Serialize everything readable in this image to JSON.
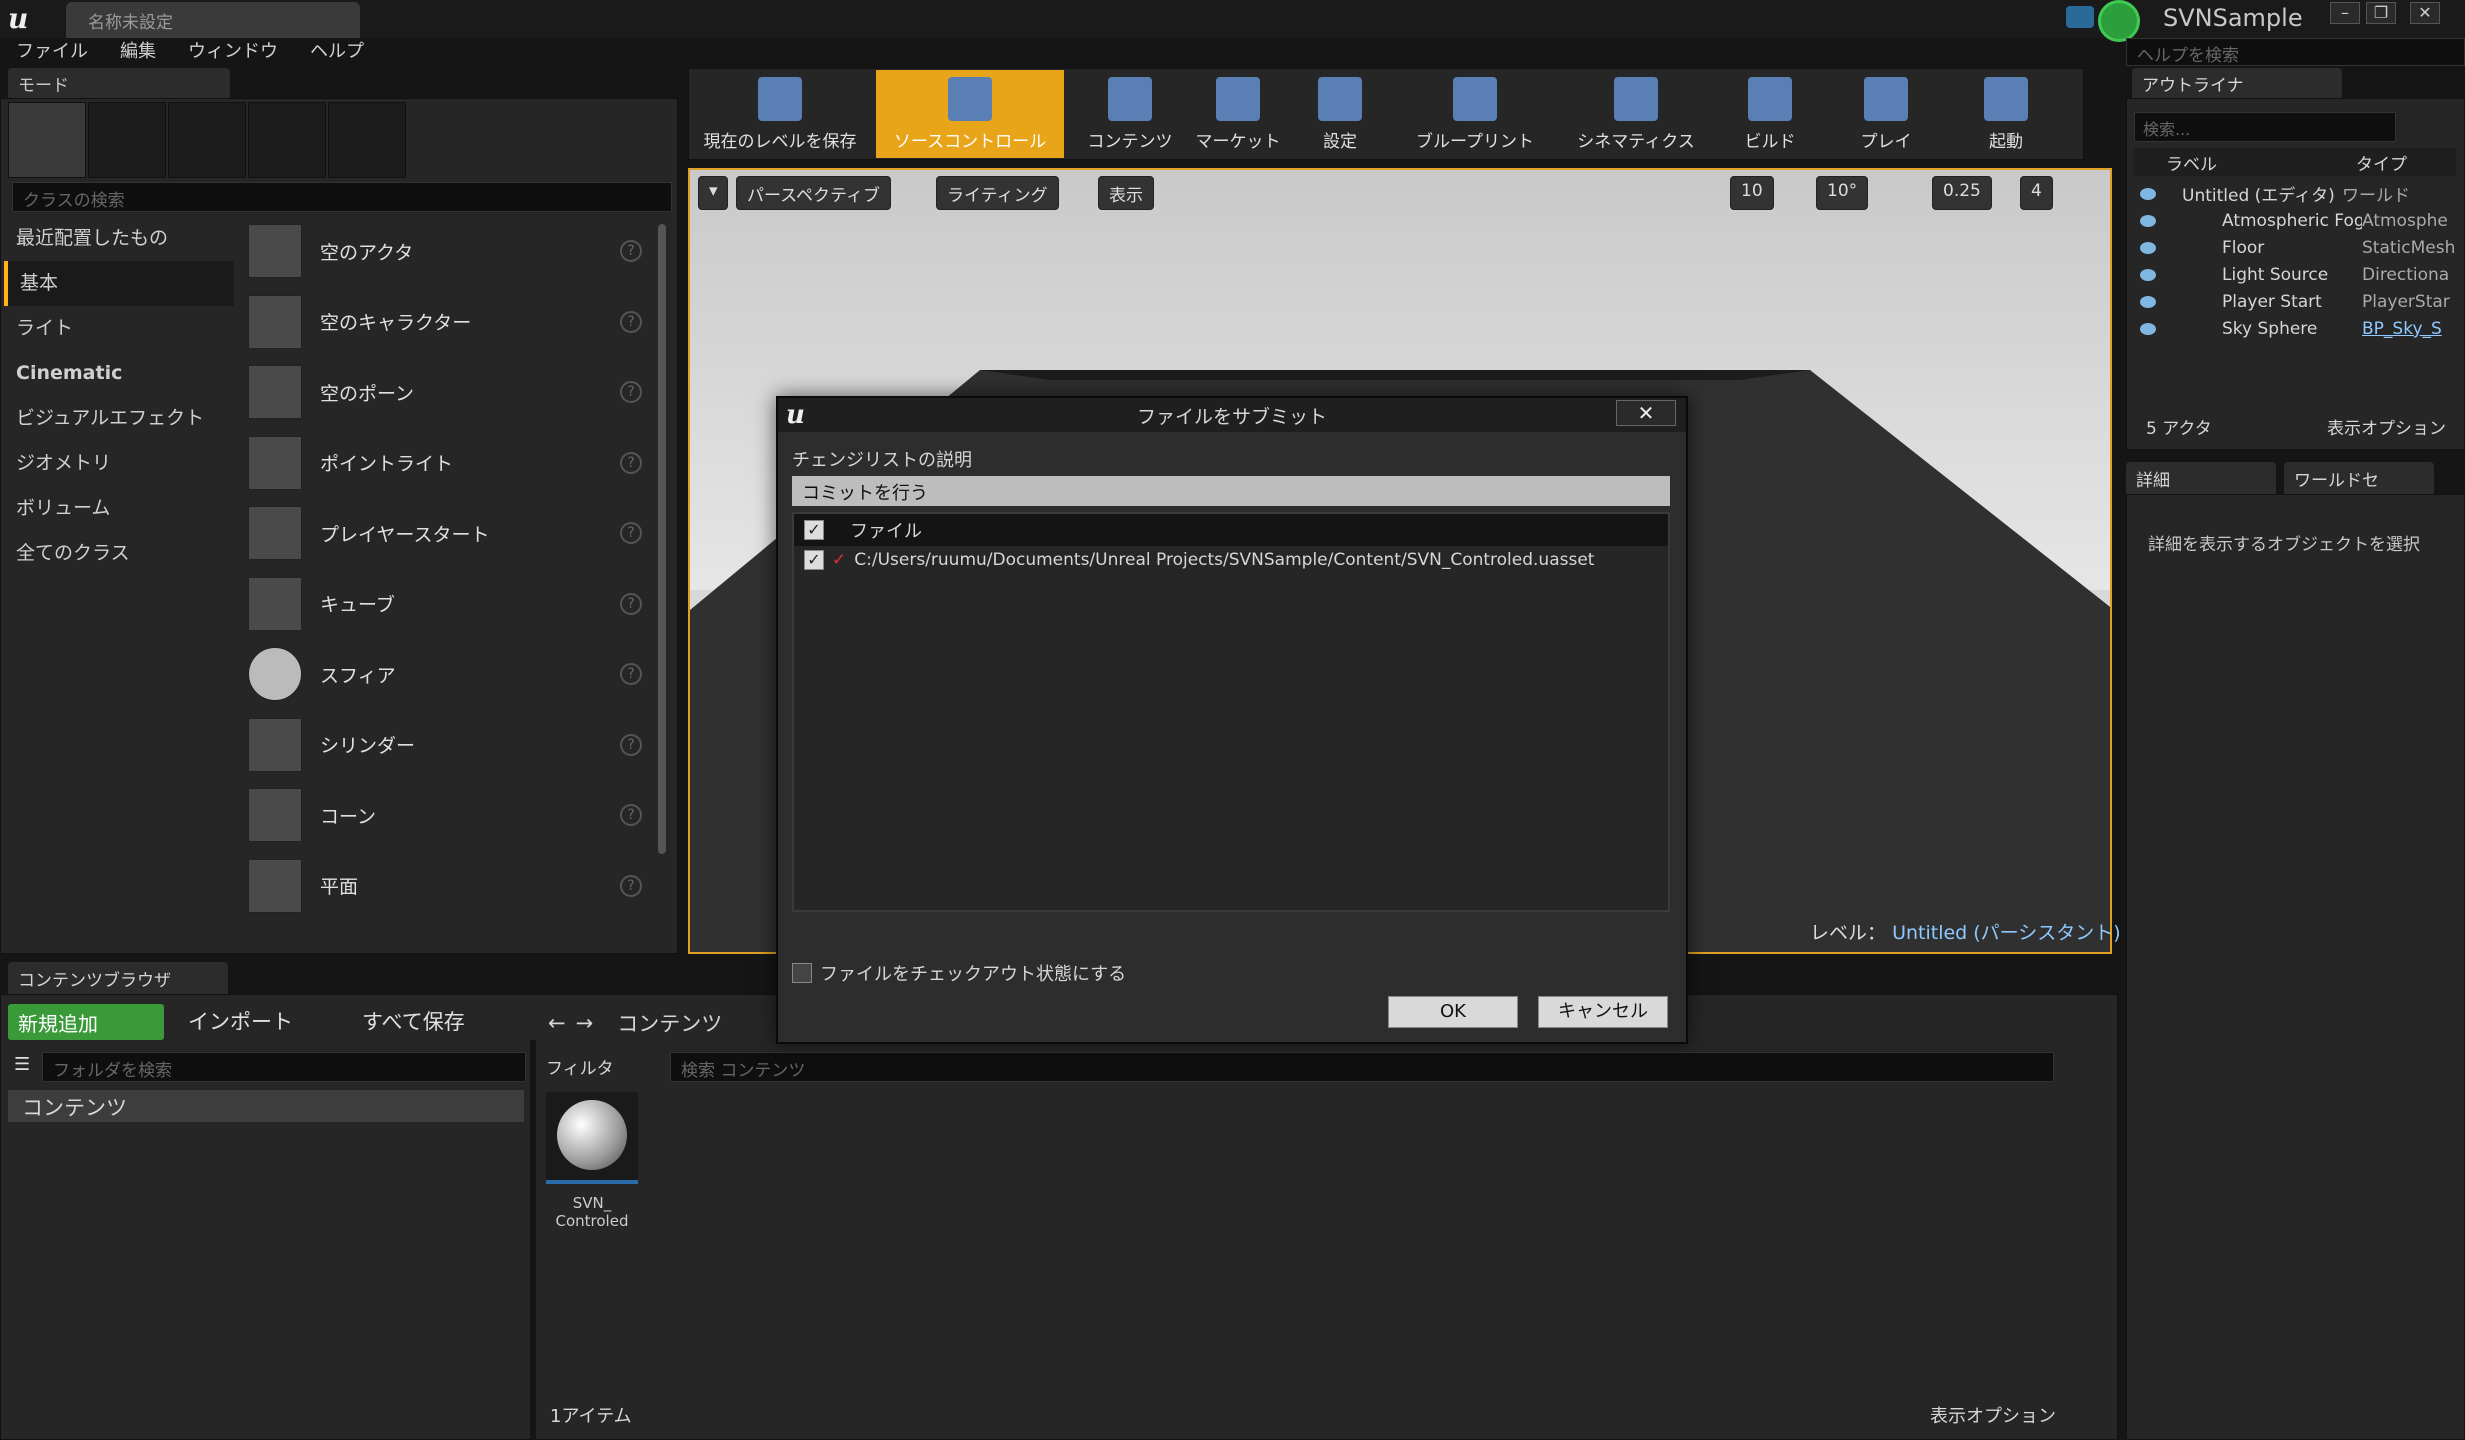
{
  "window": {
    "doc_tab": "名称未設定",
    "project": "SVNSample",
    "controls": {
      "minimize": "–",
      "restore": "❐",
      "close": "✕"
    }
  },
  "menu": [
    "ファイル",
    "編集",
    "ウィンドウ",
    "ヘルプ"
  ],
  "help_search": {
    "placeholder": "ヘルプを検索"
  },
  "modes": {
    "tab": "モード",
    "search_placeholder": "クラスの検索",
    "categories": [
      "最近配置したもの",
      "基本",
      "ライト",
      "Cinematic",
      "ビジュアルエフェクト",
      "ジオメトリ",
      "ボリューム",
      "全てのクラス"
    ],
    "selected_category": "基本",
    "assets": [
      "空のアクタ",
      "空のキャラクター",
      "空のポーン",
      "ポイントライト",
      "プレイヤースタート",
      "キューブ",
      "スフィア",
      "シリンダー",
      "コーン",
      "平面"
    ]
  },
  "toolbar": {
    "buttons": [
      {
        "label": "現在のレベルを保存",
        "icon": "save-icon"
      },
      {
        "label": "ソースコントロール",
        "icon": "source-control-icon",
        "active": true
      },
      {
        "label": "コンテンツ",
        "icon": "content-icon"
      },
      {
        "label": "マーケット",
        "icon": "market-icon"
      },
      {
        "label": "設定",
        "icon": "settings-icon"
      },
      {
        "label": "ブループリント",
        "icon": "blueprint-icon"
      },
      {
        "label": "シネマティクス",
        "icon": "cinematics-icon"
      },
      {
        "label": "ビルド",
        "icon": "build-icon"
      },
      {
        "label": "プレイ",
        "icon": "play-icon"
      },
      {
        "label": "起動",
        "icon": "launch-icon"
      }
    ]
  },
  "viewport": {
    "perspective": "パースペクティブ",
    "lighting": "ライティング",
    "show": "表示",
    "grid_snap": "10",
    "rotation_snap": "10°",
    "scale_snap": "0.25",
    "camera_speed": "4",
    "level_prefix": "レベル：",
    "level_name": "Untitled (パーシスタント)"
  },
  "outliner": {
    "tab": "アウトライナ",
    "search_placeholder": "検索...",
    "col_label": "ラベル",
    "col_type": "タイプ",
    "root": {
      "label": "Untitled (エディタ)",
      "type": "ワールド"
    },
    "rows": [
      {
        "label": "Atmospheric Fog",
        "type": "Atmosphe"
      },
      {
        "label": "Floor",
        "type": "StaticMesh"
      },
      {
        "label": "Light Source",
        "type": "Directiona"
      },
      {
        "label": "Player Start",
        "type": "PlayerStar"
      },
      {
        "label": "Sky Sphere",
        "type": "BP_Sky_S"
      }
    ],
    "count": "5 アクタ",
    "view_options": "表示オプション"
  },
  "details": {
    "tab": "詳細",
    "world_tab": "ワールドセ",
    "message": "詳細を表示するオブジェクトを選択"
  },
  "content_browser": {
    "tab": "コンテンツブラウザ",
    "add_new": "新規追加",
    "import": "インポート",
    "save_all": "すべて保存",
    "path": "コンテンツ",
    "folder_search_placeholder": "フォルダを検索",
    "folder_root": "コンテンツ",
    "filter": "フィルタ",
    "search_placeholder": "検索 コンテンツ",
    "asset_name": "SVN_ Controled",
    "item_count": "1アイテム",
    "view_options": "表示オプション"
  },
  "dialog": {
    "title": "ファイルをサブミット",
    "close": "✕",
    "desc_label": "チェンジリストの説明",
    "desc_value": "コミットを行う",
    "col_file": "ファイル",
    "files": [
      {
        "path": "C:/Users/ruumu/Documents/Unreal Projects/SVNSample/Content/SVN_Controled.uasset",
        "checked": true
      }
    ],
    "checkout_label": "ファイルをチェックアウト状態にする",
    "ok": "OK",
    "cancel": "キャンセル"
  },
  "colors": {
    "accent": "#e8a519",
    "add_new": "#3a9a3a",
    "link": "#8fc9ff"
  }
}
